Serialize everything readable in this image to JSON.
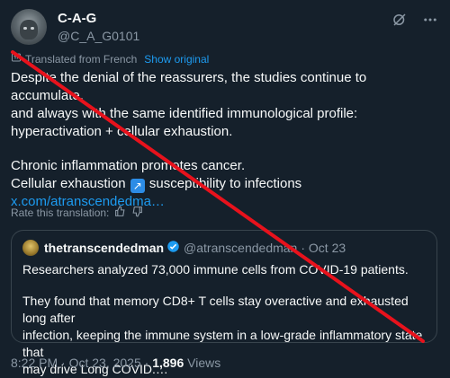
{
  "author": {
    "display_name": "C-A-G",
    "handle": "@C_A_G0101"
  },
  "translation": {
    "label": "Translated from French",
    "show_original": "Show original"
  },
  "tweet": {
    "line1": "Despite the denial of the reassurers, the studies continue to accumulate,",
    "line2": "and always with the same identified immunological profile:",
    "line3": "hyperactivation + cellular exhaustion.",
    "line4": "Chronic inflammation promotes cancer.",
    "line5_pre": "Cellular exhaustion",
    "line5_emoji": "↗",
    "line5_post": "susceptibility to infections",
    "link": "x.com/atranscendedma…"
  },
  "rate_translation": "Rate this translation:",
  "quote": {
    "name": "thetranscendedman",
    "handle": "@atranscendedman",
    "date": "· Oct 23",
    "para1": "Researchers analyzed 73,000 immune cells from COVID-19 patients.",
    "para2_l1": "They found that memory CD8+ T cells stay overactive and exhausted long after",
    "para2_l2": "infection, keeping the immune system in a low-grade inflammatory state that",
    "para2_l3": "may drive Long COVID.…"
  },
  "meta": {
    "time": "8:22 PM",
    "date": "Oct 23, 2025",
    "views_count": "1,896",
    "views_label": "Views"
  },
  "colors": {
    "background": "#15202b",
    "accent": "#1d9bf0",
    "strike_line": "#e8121c"
  },
  "icons": [
    "grok-icon",
    "more-icon",
    "translate-icon",
    "thumbs-up-icon",
    "thumbs-down-icon",
    "verified-badge-icon",
    "arrow-up-right-emoji"
  ]
}
